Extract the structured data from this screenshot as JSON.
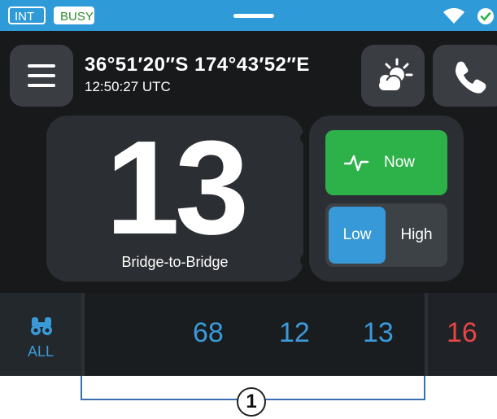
{
  "status_bar": {
    "int_label": "INT",
    "busy_label": "BUSY",
    "accent_color": "#2f9ad8",
    "busy_color": "#2b8c2b",
    "icons": [
      "wifi-icon",
      "check-circle-icon"
    ]
  },
  "header": {
    "coordinates": "36°51′20″S  174°43′52″E",
    "time": "12:50:27 UTC",
    "menu_icon": "hamburger-menu-icon",
    "weather_icon": "weather-sun-cloud-icon",
    "phone_icon": "phone-icon"
  },
  "channel": {
    "number": "13",
    "name": "Bridge-to-Bridge"
  },
  "controls": {
    "now_label": "Now",
    "now_icon": "pulse-icon",
    "now_color": "#2db24a",
    "power_low_label": "Low",
    "power_high_label": "High",
    "power_selected": "Low",
    "selected_color": "#3899d8"
  },
  "bottom_bar": {
    "scan_label": "ALL",
    "scan_icon": "binoculars-icon",
    "channels": [
      "68",
      "12",
      "13"
    ],
    "priority_channel": "16",
    "channel_color": "#3a9ad9",
    "priority_color": "#e64545"
  },
  "callout": {
    "number": "1"
  }
}
